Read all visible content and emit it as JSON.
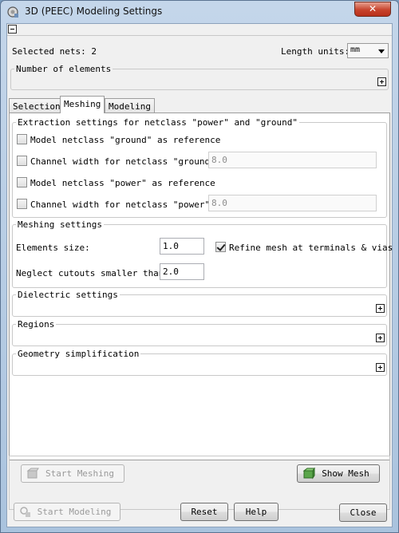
{
  "window": {
    "title": "3D (PEEC) Modeling Settings",
    "close_glyph": "✕"
  },
  "header": {
    "selected_nets": "Selected nets: 2",
    "length_units_label": "Length units:",
    "length_units_value": "mm"
  },
  "number_of_elements": {
    "title": "Number of elements"
  },
  "tabs": [
    {
      "label": "Selection",
      "active": false
    },
    {
      "label": "Meshing",
      "active": true
    },
    {
      "label": "Modeling",
      "active": false
    }
  ],
  "extraction": {
    "title": "Extraction settings for netclass \"power\" and \"ground\"",
    "rows": [
      {
        "label": "Model netclass \"ground\" as reference",
        "checked": false
      },
      {
        "label": "Channel width for netclass \"ground\":",
        "checked": false,
        "value": "8.0"
      },
      {
        "label": "Model netclass \"power\" as reference",
        "checked": false
      },
      {
        "label": "Channel width for netclass \"power\":",
        "checked": false,
        "value": "8.0"
      }
    ]
  },
  "meshing": {
    "title": "Meshing settings",
    "element_size_label": "Elements size:",
    "element_size_value": "1.0",
    "refine_label": "Refine mesh at terminals & vias",
    "refine_checked": true,
    "neglect_label": "Neglect cutouts smaller than:",
    "neglect_value": "2.0"
  },
  "sections": {
    "dielectric": "Dielectric settings",
    "regions": "Regions",
    "geometry": "Geometry simplification"
  },
  "panel_buttons": {
    "start_meshing": "Start Meshing",
    "show_mesh": "Show Mesh"
  },
  "footer": {
    "start_modeling": "Start Modeling",
    "reset": "Reset",
    "help": "Help",
    "close": "Close"
  }
}
